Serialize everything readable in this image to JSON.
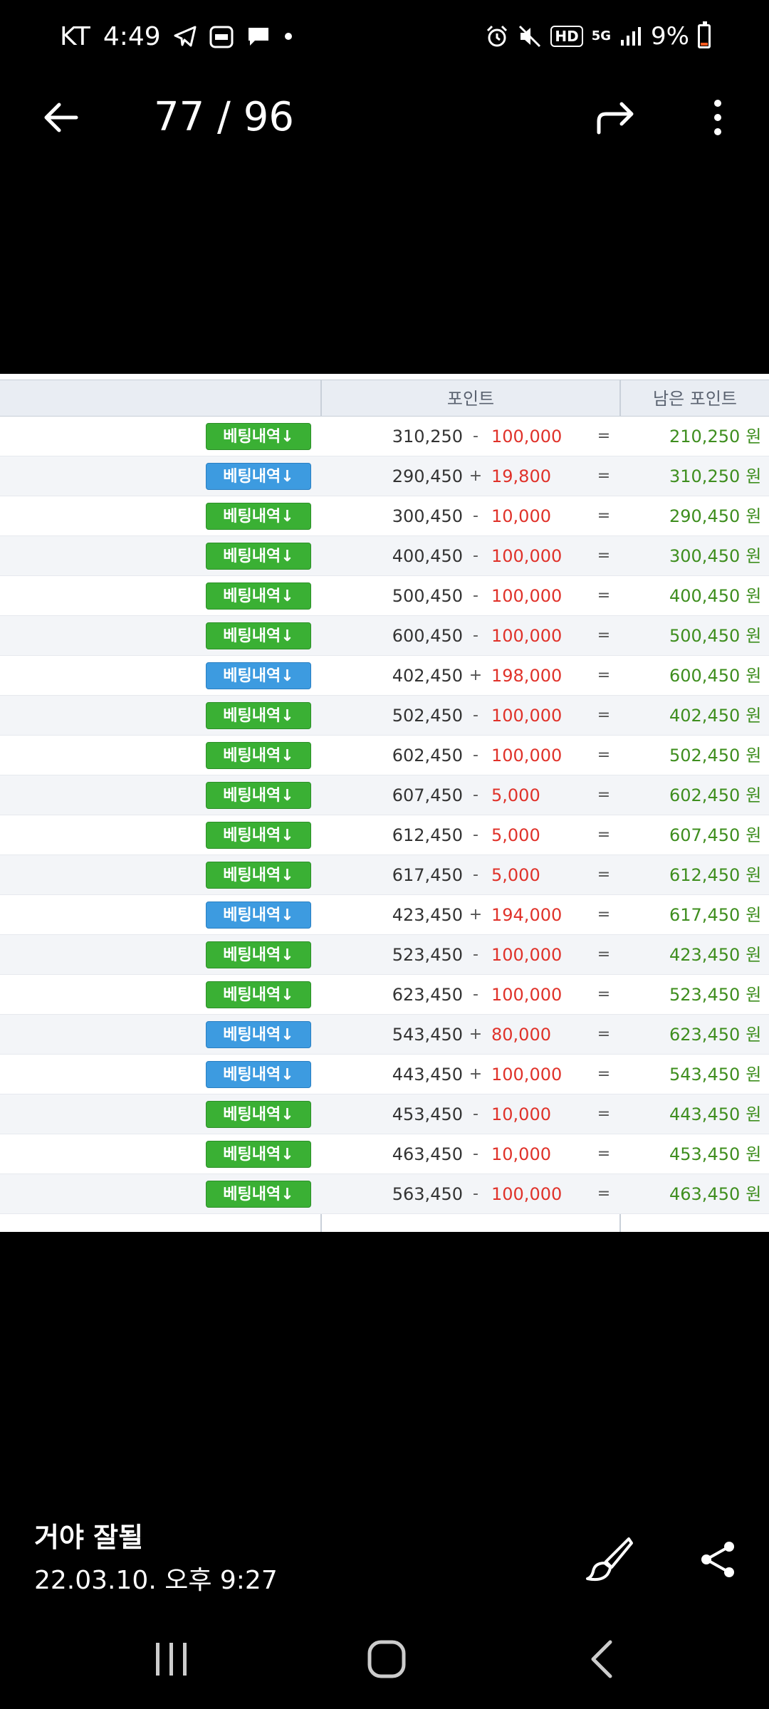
{
  "status_bar": {
    "carrier": "KT",
    "time": "4:49",
    "hd_label": "HD",
    "network_label": "5G",
    "battery_percent": "9%",
    "icons": [
      "telegram-icon",
      "app-notification-icon",
      "message-icon",
      "dot-icon",
      "alarm-icon",
      "mute-icon",
      "hd-icon",
      "5g-icon",
      "signal-icon",
      "battery-icon"
    ]
  },
  "top_bar": {
    "page_counter": "77 / 96",
    "icons": [
      "back-arrow-icon",
      "forward-share-icon",
      "more-vert-icon"
    ]
  },
  "table": {
    "headers": {
      "points": "포인트",
      "remaining": "남은 포인트"
    },
    "button_label": "베팅내역↓",
    "unit": "원",
    "colors": {
      "green_button": "#3ab034",
      "blue_button": "#3d9be0",
      "amount": "#e0322a",
      "remaining": "#3e8e1e"
    },
    "rows": [
      {
        "button_color": "green",
        "previous": "310,250",
        "sign": "-",
        "amount": "100,000",
        "eq": "=",
        "remaining": "210,250"
      },
      {
        "button_color": "blue",
        "previous": "290,450",
        "sign": "+",
        "amount": "19,800",
        "eq": "=",
        "remaining": "310,250"
      },
      {
        "button_color": "green",
        "previous": "300,450",
        "sign": "-",
        "amount": "10,000",
        "eq": "=",
        "remaining": "290,450"
      },
      {
        "button_color": "green",
        "previous": "400,450",
        "sign": "-",
        "amount": "100,000",
        "eq": "=",
        "remaining": "300,450"
      },
      {
        "button_color": "green",
        "previous": "500,450",
        "sign": "-",
        "amount": "100,000",
        "eq": "=",
        "remaining": "400,450"
      },
      {
        "button_color": "green",
        "previous": "600,450",
        "sign": "-",
        "amount": "100,000",
        "eq": "=",
        "remaining": "500,450"
      },
      {
        "button_color": "blue",
        "previous": "402,450",
        "sign": "+",
        "amount": "198,000",
        "eq": "=",
        "remaining": "600,450"
      },
      {
        "button_color": "green",
        "previous": "502,450",
        "sign": "-",
        "amount": "100,000",
        "eq": "=",
        "remaining": "402,450"
      },
      {
        "button_color": "green",
        "previous": "602,450",
        "sign": "-",
        "amount": "100,000",
        "eq": "=",
        "remaining": "502,450"
      },
      {
        "button_color": "green",
        "previous": "607,450",
        "sign": "-",
        "amount": "5,000",
        "eq": "=",
        "remaining": "602,450"
      },
      {
        "button_color": "green",
        "previous": "612,450",
        "sign": "-",
        "amount": "5,000",
        "eq": "=",
        "remaining": "607,450"
      },
      {
        "button_color": "green",
        "previous": "617,450",
        "sign": "-",
        "amount": "5,000",
        "eq": "=",
        "remaining": "612,450"
      },
      {
        "button_color": "blue",
        "previous": "423,450",
        "sign": "+",
        "amount": "194,000",
        "eq": "=",
        "remaining": "617,450"
      },
      {
        "button_color": "green",
        "previous": "523,450",
        "sign": "-",
        "amount": "100,000",
        "eq": "=",
        "remaining": "423,450"
      },
      {
        "button_color": "green",
        "previous": "623,450",
        "sign": "-",
        "amount": "100,000",
        "eq": "=",
        "remaining": "523,450"
      },
      {
        "button_color": "blue",
        "previous": "543,450",
        "sign": "+",
        "amount": "80,000",
        "eq": "=",
        "remaining": "623,450"
      },
      {
        "button_color": "blue",
        "previous": "443,450",
        "sign": "+",
        "amount": "100,000",
        "eq": "=",
        "remaining": "543,450"
      },
      {
        "button_color": "green",
        "previous": "453,450",
        "sign": "-",
        "amount": "10,000",
        "eq": "=",
        "remaining": "443,450"
      },
      {
        "button_color": "green",
        "previous": "463,450",
        "sign": "-",
        "amount": "10,000",
        "eq": "=",
        "remaining": "453,450"
      },
      {
        "button_color": "green",
        "previous": "563,450",
        "sign": "-",
        "amount": "100,000",
        "eq": "=",
        "remaining": "463,450"
      }
    ]
  },
  "caption": {
    "title": "거야 잘될",
    "date": "22.03.10. 오후 9:27",
    "icons": [
      "brush-edit-icon",
      "share-icon"
    ]
  },
  "nav_bar": {
    "icons": [
      "recent-apps-icon",
      "home-icon",
      "back-nav-icon"
    ]
  }
}
